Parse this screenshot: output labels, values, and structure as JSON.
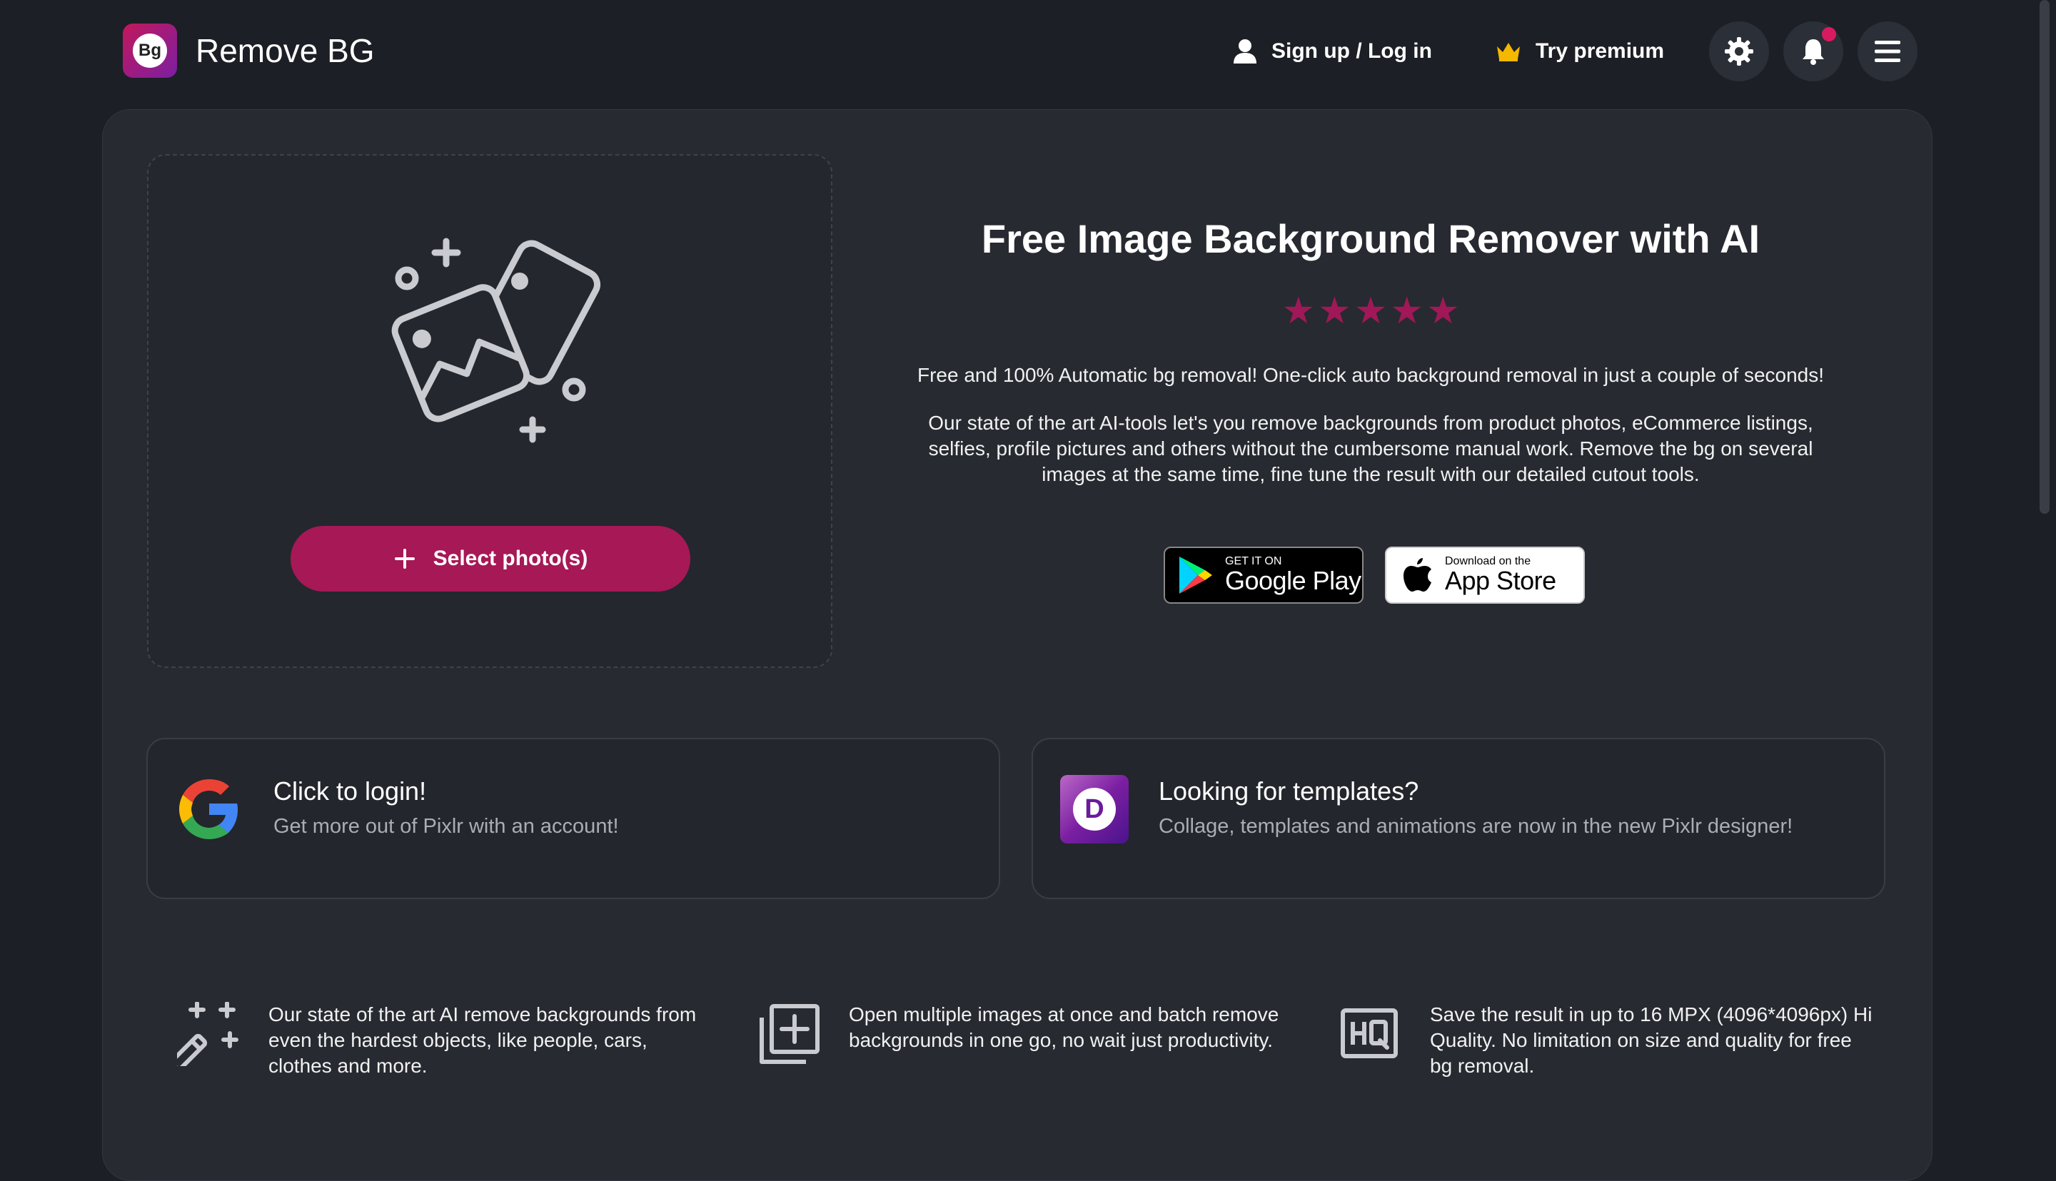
{
  "header": {
    "logo_badge": "Bg",
    "app_name": "Remove BG",
    "signup_label": "Sign up / Log in",
    "premium_label": "Try premium"
  },
  "hero": {
    "select_button": "Select photo(s)",
    "title": "Free Image Background Remover with AI",
    "rating_stars": 5,
    "lead": "Free and 100% Automatic bg removal! One-click auto background removal in just a couple of seconds!",
    "description": "Our state of the art AI-tools let's you remove backgrounds from product photos, eCommerce listings, selfies, profile pictures and others without the cumbersome manual work. Remove the bg on several images at the same time, fine tune the result with our detailed cutout tools.",
    "google_play_small": "GET IT ON",
    "google_play_big": "Google Play",
    "app_store_small": "Download on the",
    "app_store_big": "App Store"
  },
  "cards": [
    {
      "title": "Click to login!",
      "text": "Get more out of Pixlr with an account!",
      "icon": "google-icon"
    },
    {
      "title": "Looking for templates?",
      "text": "Collage, templates and animations are now in the new Pixlr designer!",
      "icon": "pixlr-designer-icon",
      "icon_letter": "D"
    }
  ],
  "features": [
    {
      "icon": "magic-wand-icon",
      "text": "Our state of the art AI remove backgrounds from even the hardest objects, like people, cars, clothes and more."
    },
    {
      "icon": "add-multiple-icon",
      "text": "Open multiple images at once and batch remove backgrounds in one go, no wait just productivity."
    },
    {
      "icon": "hq-icon",
      "text": "Save the result in up to 16 MPX (4096*4096px) Hi Quality. No limitation on size and quality for free bg removal."
    }
  ],
  "colors": {
    "background": "#1c1f25",
    "panel": "#272a31",
    "accent": "#a61856",
    "star": "#a01857",
    "notification_dot": "#d81b60"
  }
}
